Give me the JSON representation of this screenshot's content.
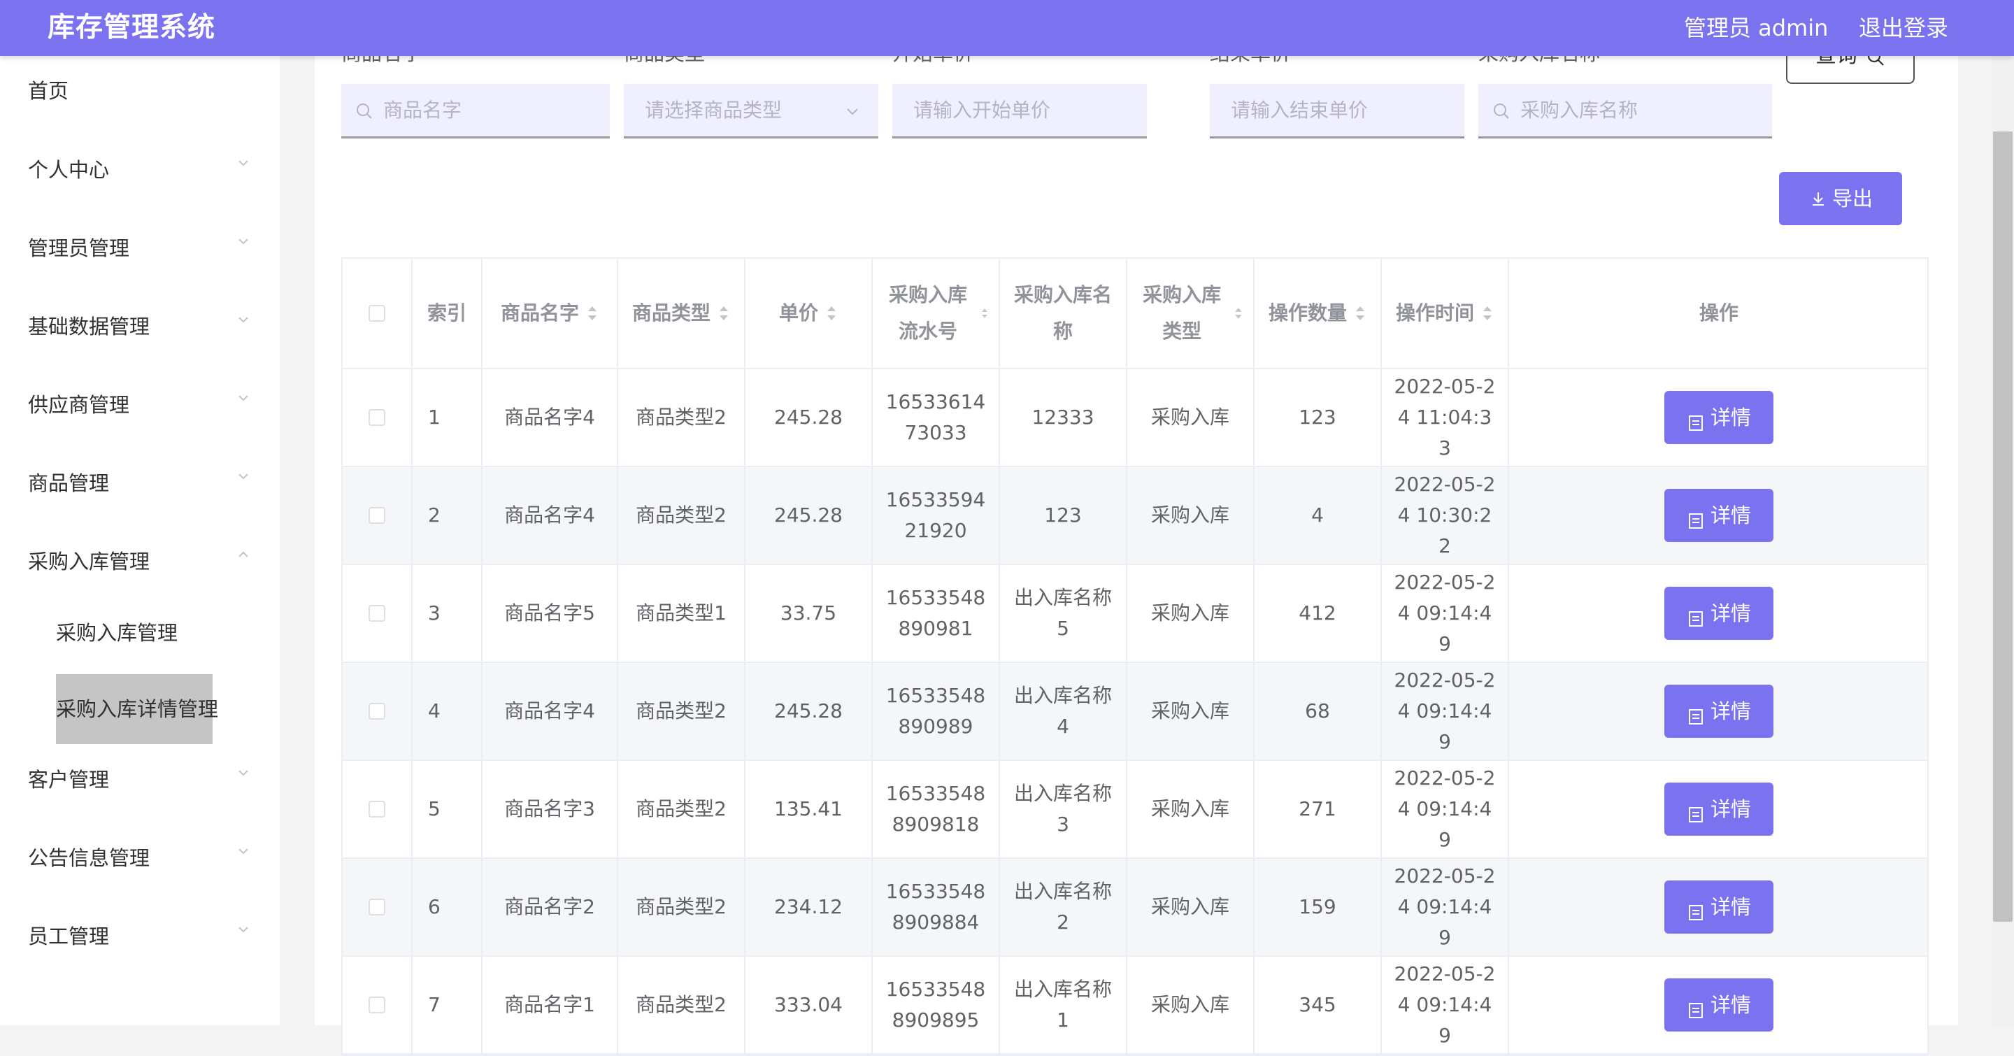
{
  "app": {
    "title": "库存管理系统",
    "user": "管理员 admin",
    "logout": "退出登录"
  },
  "sidebar": {
    "items": [
      {
        "label": "首页",
        "expandable": false
      },
      {
        "label": "个人中心",
        "expandable": true
      },
      {
        "label": "管理员管理",
        "expandable": true
      },
      {
        "label": "基础数据管理",
        "expandable": true
      },
      {
        "label": "供应商管理",
        "expandable": true
      },
      {
        "label": "商品管理",
        "expandable": true
      },
      {
        "label": "采购入库管理",
        "expandable": true,
        "expanded": true
      },
      {
        "label": "客户管理",
        "expandable": true
      },
      {
        "label": "公告信息管理",
        "expandable": true
      },
      {
        "label": "员工管理",
        "expandable": true
      }
    ],
    "subitems": [
      {
        "label": "采购入库管理",
        "active": false
      },
      {
        "label": "采购入库详情管理",
        "active": true
      }
    ]
  },
  "filters": {
    "product_name": {
      "label": "商品名字",
      "placeholder": "商品名字"
    },
    "product_type": {
      "label": "商品类型",
      "placeholder": "请选择商品类型"
    },
    "start_price": {
      "label": "开始单价",
      "placeholder": "请输入开始单价"
    },
    "range_separator": "-",
    "end_price": {
      "label": "结束单价",
      "placeholder": "请输入结束单价"
    },
    "purchase_name": {
      "label": "采购入库名称",
      "placeholder": "采购入库名称"
    },
    "query_label": "查询"
  },
  "toolbar": {
    "export_label": "导出"
  },
  "table": {
    "columns": [
      "",
      "索引",
      "商品名字",
      "商品类型",
      "单价",
      "采购入库流水号",
      "采购入库名称",
      "采购入库类型",
      "操作数量",
      "操作时间",
      "操作"
    ],
    "detail_label": "详情",
    "rows": [
      [
        "1",
        "商品名字4",
        "商品类型2",
        "245.28",
        "1653361473033",
        "12333",
        "采购入库",
        "123",
        "2022-05-24 11:04:33"
      ],
      [
        "2",
        "商品名字4",
        "商品类型2",
        "245.28",
        "1653359421920",
        "123",
        "采购入库",
        "4",
        "2022-05-24 10:30:22"
      ],
      [
        "3",
        "商品名字5",
        "商品类型1",
        "33.75",
        "16533548890981",
        "出入库名称5",
        "采购入库",
        "412",
        "2022-05-24 09:14:49"
      ],
      [
        "4",
        "商品名字4",
        "商品类型2",
        "245.28",
        "16533548890989",
        "出入库名称4",
        "采购入库",
        "68",
        "2022-05-24 09:14:49"
      ],
      [
        "5",
        "商品名字3",
        "商品类型2",
        "135.41",
        "165335488909818",
        "出入库名称3",
        "采购入库",
        "271",
        "2022-05-24 09:14:49"
      ],
      [
        "6",
        "商品名字2",
        "商品类型2",
        "234.12",
        "165335488909884",
        "出入库名称2",
        "采购入库",
        "159",
        "2022-05-24 09:14:49"
      ],
      [
        "7",
        "商品名字1",
        "商品类型2",
        "333.04",
        "165335488909895",
        "出入库名称1",
        "采购入库",
        "345",
        "2022-05-24 09:14:49"
      ]
    ]
  },
  "colors": {
    "accent": "#7b72f0",
    "input_bg": "#f0effd",
    "stripe": "#f5f6f8"
  }
}
